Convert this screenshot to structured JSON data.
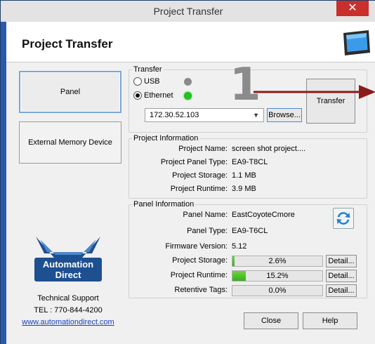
{
  "window": {
    "title": "Project Transfer",
    "close_glyph": "✕"
  },
  "header": {
    "title": "Project Transfer",
    "icon": "monitor-icon"
  },
  "sidebar": {
    "panel_button": "Panel",
    "external_button": "External Memory Device",
    "logo_line1": "Automation",
    "logo_line2": "Direct",
    "support_title": "Technical Support",
    "support_phone": "TEL : 770-844-4200",
    "support_link": "www.automationdirect.com"
  },
  "callout": {
    "number": "1",
    "arrow_color": "#8b1a1a"
  },
  "transfer": {
    "group_label": "Transfer",
    "usb_label": "USB",
    "ethernet_label": "Ethernet",
    "selected": "Ethernet",
    "usb_status_color": "#8a8a8a",
    "ethernet_status_color": "#22c322",
    "address": "172.30.52.103",
    "browse_label": "Browse...",
    "transfer_label": "Transfer"
  },
  "project_info": {
    "group_label": "Project Information",
    "rows": [
      {
        "key": "Project Name:",
        "value": "screen shot project...."
      },
      {
        "key": "Project Panel Type:",
        "value": "EA9-T8CL"
      },
      {
        "key": "Project Storage:",
        "value": "1.1 MB"
      },
      {
        "key": "Project Runtime:",
        "value": "3.9 MB"
      }
    ]
  },
  "panel_info": {
    "group_label": "Panel Information",
    "panel_name_key": "Panel Name:",
    "panel_name": "EastCoyoteCmore",
    "panel_type_key": "Panel Type:",
    "panel_type": "EA9-T6CL",
    "firmware_key": "Firmware Version:",
    "firmware": "5.12",
    "storage_key": "Project Storage:",
    "storage_pct": "2.6%",
    "storage_fraction": 0.026,
    "runtime_key": "Project Runtime:",
    "runtime_pct": "15.2%",
    "runtime_fraction": 0.152,
    "retentive_key": "Retentive Tags:",
    "retentive_pct": "0.0%",
    "retentive_fraction": 0.0,
    "detail_label": "Detail...",
    "refresh_icon": "refresh-icon"
  },
  "footer": {
    "close_label": "Close",
    "help_label": "Help"
  }
}
